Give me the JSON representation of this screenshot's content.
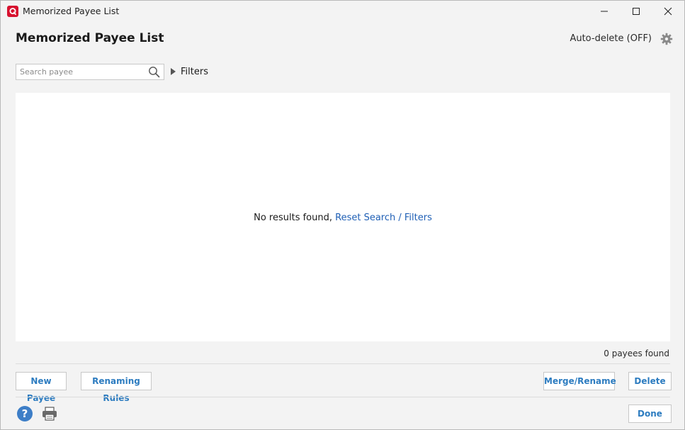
{
  "window": {
    "title": "Memorized Payee List",
    "controls": [
      "minimize-icon",
      "maximize-icon",
      "close-icon"
    ]
  },
  "header": {
    "title": "Memorized Payee List",
    "auto_delete_label": "Auto-delete (OFF)",
    "settings_icon": "gear-icon"
  },
  "search": {
    "placeholder": "Search payee",
    "value": "",
    "icon": "search-icon"
  },
  "filters": {
    "label": "Filters",
    "expanded": false
  },
  "results": {
    "empty_message": "No results found,",
    "reset_link": "Reset Search / Filters",
    "count_text": "0 payees found"
  },
  "actions": {
    "new_payee": "New Payee",
    "renaming_rules": "Renaming Rules",
    "merge_rename": "Merge/Rename",
    "delete": "Delete",
    "done": "Done"
  },
  "footer": {
    "help_icon": "help-icon",
    "print_icon": "printer-icon",
    "help_glyph": "?"
  },
  "colors": {
    "accent": "#2d7cc0",
    "link": "#1f5fb5",
    "brand": "#d7112f",
    "help": "#3d7ec7"
  }
}
